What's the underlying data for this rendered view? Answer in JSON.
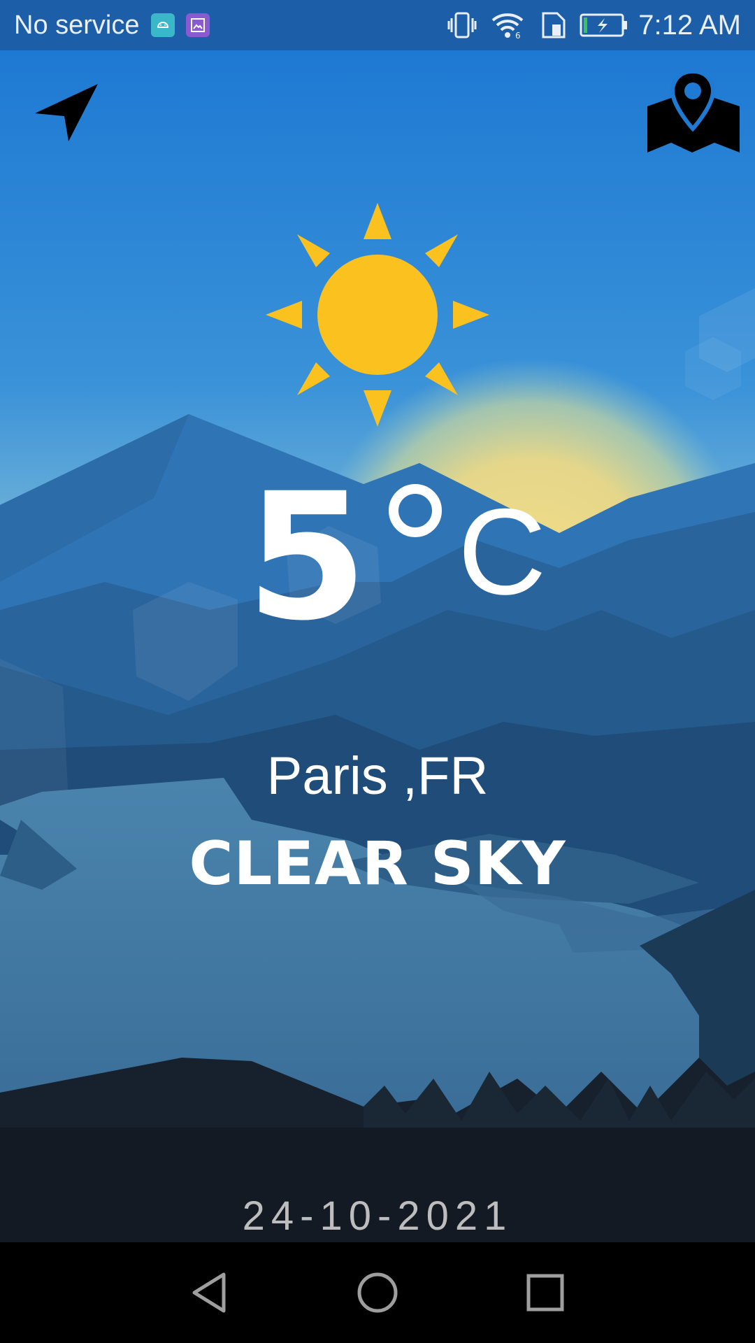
{
  "status_bar": {
    "carrier": "No service",
    "time": "7:12 AM",
    "icons": [
      "android-notification-icon",
      "image-notification-icon",
      "vibrate-icon",
      "wifi-icon",
      "sim-icon",
      "battery-charging-icon"
    ],
    "colors": {
      "background": "#1c5fa8",
      "android_badge": "#3ab7c9",
      "image_badge": "#8a5ad1"
    }
  },
  "toolbar": {
    "location_button_icon": "navigation-arrow-icon",
    "map_button_icon": "map-pin-icon"
  },
  "weather": {
    "temperature": "5",
    "unit": "C",
    "city": "Paris ,FR",
    "condition": "CLEAR SKY",
    "icon": "sun-icon",
    "date": "24-10-2021"
  },
  "nav_bar": {
    "buttons": [
      "back-icon",
      "home-icon",
      "recents-icon"
    ]
  },
  "theme": {
    "sky_top": "#1f7ad4",
    "sky_bottom": "#5aa6d6",
    "sun": "#fbc11f",
    "foreground_dark": "#141a24"
  }
}
